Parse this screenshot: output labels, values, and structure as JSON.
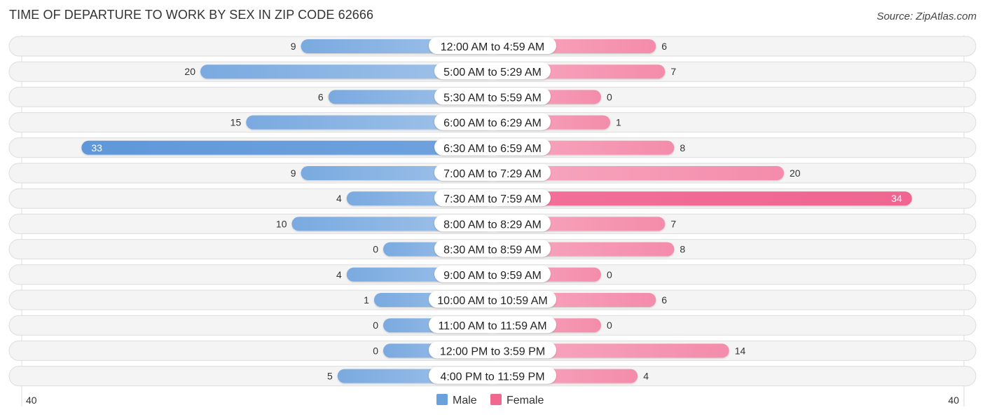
{
  "header": {
    "title": "TIME OF DEPARTURE TO WORK BY SEX IN ZIP CODE 62666",
    "source": "Source: ZipAtlas.com"
  },
  "colors": {
    "male": "#6aa0dc",
    "male_light": "#a9c8ec",
    "female": "#f06890",
    "female_light": "#f6a8c0"
  },
  "chart_data": {
    "type": "bar",
    "orientation": "horizontal-diverging",
    "title": "TIME OF DEPARTURE TO WORK BY SEX IN ZIP CODE 62666",
    "categories": [
      "12:00 AM to 4:59 AM",
      "5:00 AM to 5:29 AM",
      "5:30 AM to 5:59 AM",
      "6:00 AM to 6:29 AM",
      "6:30 AM to 6:59 AM",
      "7:00 AM to 7:29 AM",
      "7:30 AM to 7:59 AM",
      "8:00 AM to 8:29 AM",
      "8:30 AM to 8:59 AM",
      "9:00 AM to 9:59 AM",
      "10:00 AM to 10:59 AM",
      "11:00 AM to 11:59 AM",
      "12:00 PM to 3:59 PM",
      "4:00 PM to 11:59 PM"
    ],
    "series": [
      {
        "name": "Male",
        "values": [
          9,
          20,
          6,
          15,
          33,
          9,
          4,
          10,
          0,
          4,
          1,
          0,
          0,
          5
        ]
      },
      {
        "name": "Female",
        "values": [
          6,
          7,
          0,
          1,
          8,
          20,
          34,
          7,
          8,
          0,
          6,
          0,
          14,
          4
        ]
      }
    ],
    "axis": {
      "left_label": "40",
      "right_label": "40",
      "range": [
        0,
        40
      ]
    },
    "legend": {
      "position": "bottom-center",
      "entries": [
        "Male",
        "Female"
      ]
    },
    "xlabel": "",
    "ylabel": ""
  }
}
